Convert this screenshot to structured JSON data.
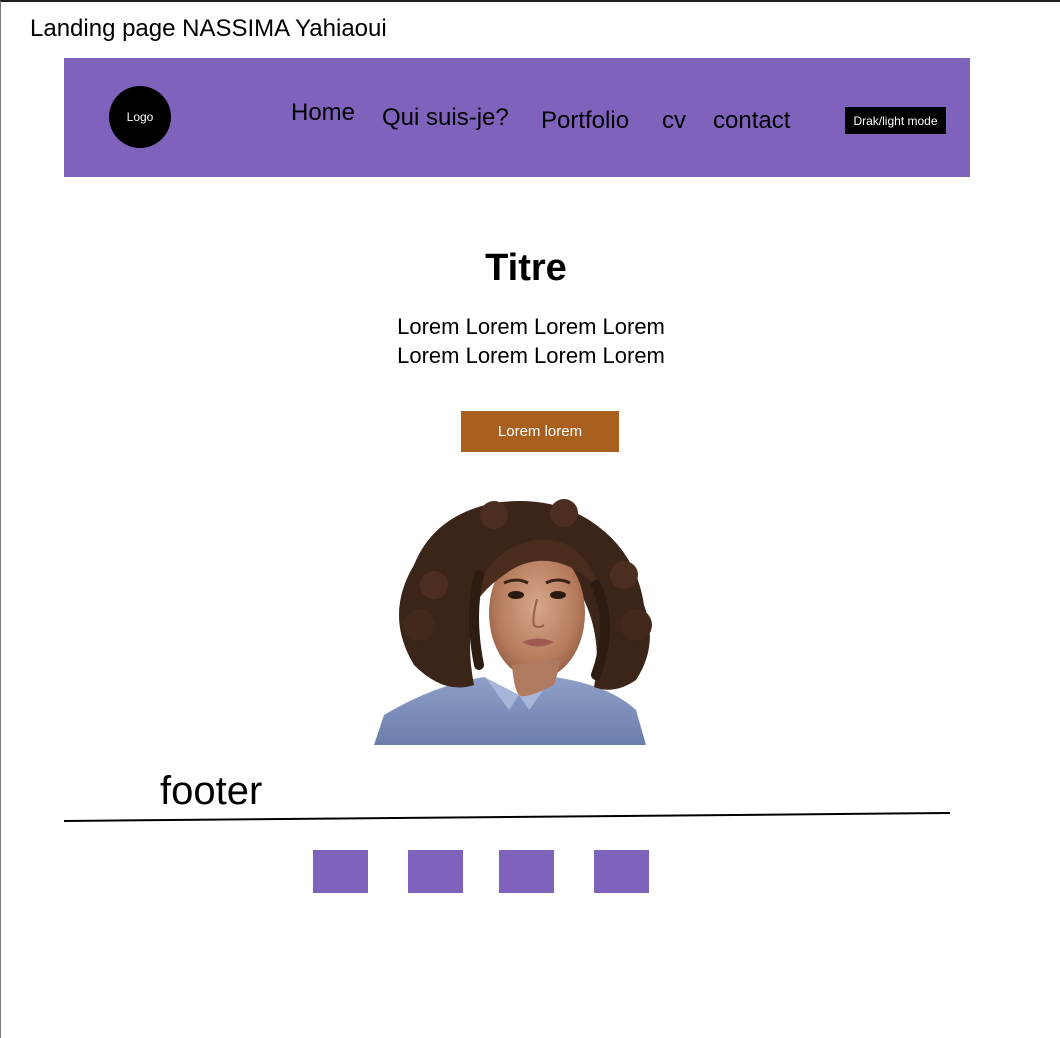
{
  "page": {
    "title": "Landing page NASSIMA Yahiaoui"
  },
  "colors": {
    "primary": "#7F62BC",
    "cta": "#A9601F",
    "dark": "#000000",
    "background": "#FFFFFF"
  },
  "navbar": {
    "logo_label": "Logo",
    "items": [
      {
        "label": "Home"
      },
      {
        "label": "Qui suis-je?"
      },
      {
        "label": "Portfolio"
      },
      {
        "label": "cv"
      },
      {
        "label": "contact"
      }
    ],
    "mode_toggle_label": "Drak/light mode"
  },
  "hero": {
    "title": "Titre",
    "lines": [
      "Lorem Lorem Lorem Lorem",
      "Lorem Lorem Lorem Lorem"
    ],
    "button_label": "Lorem lorem"
  },
  "footer": {
    "label": "footer",
    "social_links": [
      {
        "icon": "social-icon-placeholder"
      },
      {
        "icon": "social-icon-placeholder"
      },
      {
        "icon": "social-icon-placeholder"
      },
      {
        "icon": "social-icon-placeholder"
      }
    ]
  }
}
